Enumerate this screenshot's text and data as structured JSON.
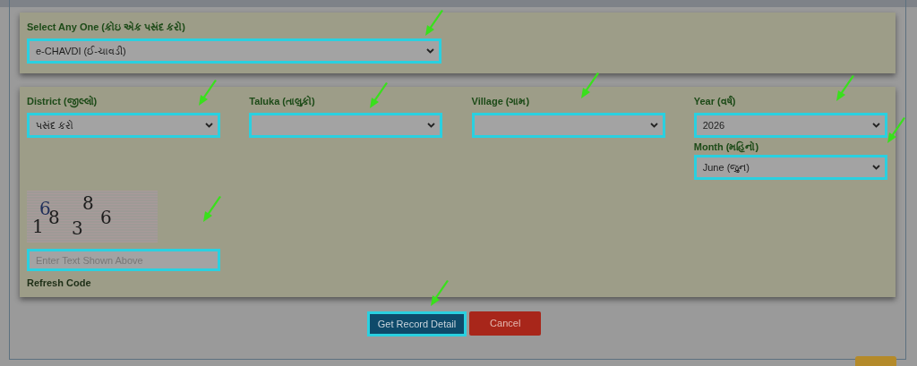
{
  "record_type": {
    "label": "Select Any One (કોઇ એક પસંદ કરો)",
    "value": "e-CHAVDI (ઈ-ચાવડી)"
  },
  "fields": [
    {
      "label": "District (જીલ્લો)",
      "value": "પસંદ કરો"
    },
    {
      "label": "Taluka (તાલુકો)"
    },
    {
      "label": "Village (ગામ)"
    },
    {
      "label": "Year (વર્ષ)",
      "value": "2026"
    }
  ],
  "month": {
    "label": "Month (મહિનો)",
    "value": "June (જુન)"
  },
  "captcha": {
    "characters": [
      "1",
      "6",
      "8",
      "3",
      "8",
      "6"
    ],
    "placeholder": "Enter Text Shown Above",
    "refresh": "Refresh Code"
  },
  "buttons": [
    {
      "kind": "primary",
      "label": "Get Record Detail"
    },
    {
      "kind": "danger",
      "label": "Cancel"
    }
  ]
}
